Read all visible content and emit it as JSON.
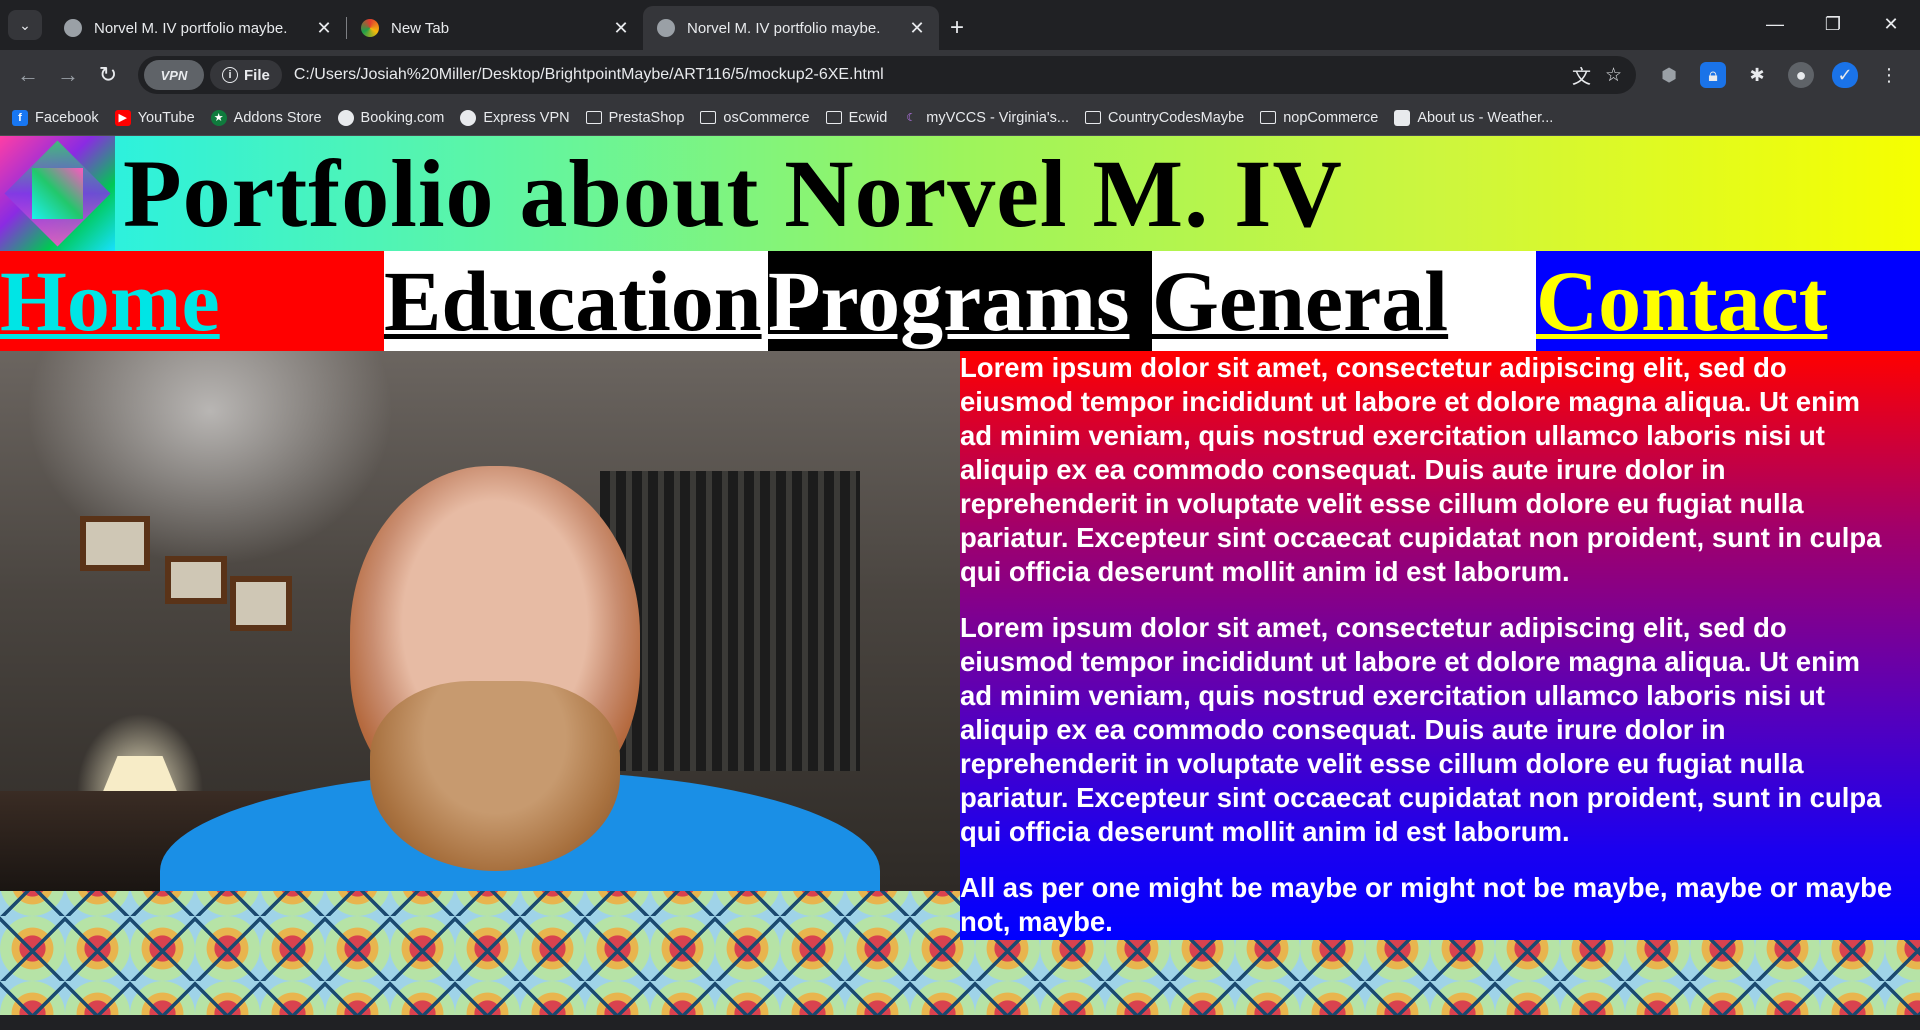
{
  "browser": {
    "tabs": [
      {
        "title": "Norvel M. IV portfolio maybe.",
        "active": false
      },
      {
        "title": "New Tab",
        "active": false
      },
      {
        "title": "Norvel M. IV portfolio maybe.",
        "active": true
      }
    ],
    "address": {
      "vpn_label": "VPN",
      "chip_label": "File",
      "url": "C:/Users/Josiah%20Miller/Desktop/BrightpointMaybe/ART116/5/mockup2-6XE.html"
    },
    "bookmarks": [
      {
        "label": "Facebook",
        "icon": "facebook-icon"
      },
      {
        "label": "YouTube",
        "icon": "youtube-icon"
      },
      {
        "label": "Addons Store",
        "icon": "addons-icon"
      },
      {
        "label": "Booking.com",
        "icon": "globe-icon"
      },
      {
        "label": "Express VPN",
        "icon": "globe-icon"
      },
      {
        "label": "PrestaShop",
        "icon": "folder-icon"
      },
      {
        "label": "osCommerce",
        "icon": "folder-icon"
      },
      {
        "label": "Ecwid",
        "icon": "folder-icon"
      },
      {
        "label": "myVCCS - Virginia's...",
        "icon": "vccs-icon"
      },
      {
        "label": "CountryCodesMaybe",
        "icon": "folder-icon"
      },
      {
        "label": "nopCommerce",
        "icon": "folder-icon"
      },
      {
        "label": "About us - Weather...",
        "icon": "page-icon"
      }
    ]
  },
  "page": {
    "title": "Portfolio about Norvel M. IV",
    "nav": [
      "Home",
      "Education",
      "Programs",
      "General",
      "Contact"
    ],
    "paragraphs": [
      "Lorem ipsum dolor sit amet, consectetur adipiscing elit, sed do eiusmod tempor incididunt ut labore et dolore magna aliqua. Ut enim ad minim veniam, quis nostrud exercitation ullamco laboris nisi ut aliquip ex ea commodo consequat. Duis aute irure dolor in reprehenderit in voluptate velit esse cillum dolore eu fugiat nulla pariatur. Excepteur sint occaecat cupidatat non proident, sunt in culpa qui officia deserunt mollit anim id est laborum.",
      "Lorem ipsum dolor sit amet, consectetur adipiscing elit, sed do eiusmod tempor incididunt ut labore et dolore magna aliqua. Ut enim ad minim veniam, quis nostrud exercitation ullamco laboris nisi ut aliquip ex ea commodo consequat. Duis aute irure dolor in reprehenderit in voluptate velit esse cillum dolore eu fugiat nulla pariatur. Excepteur sint occaecat cupidatat non proident, sunt in culpa qui officia deserunt mollit anim id est laborum.",
      "All as per one might be maybe or might not be maybe, maybe or maybe not, maybe."
    ]
  },
  "colors": {
    "nav_home_bg": "#ff0000",
    "nav_contact_bg": "#0000ff",
    "header_gradient_start": "#1ef0ee",
    "header_gradient_end": "#f6ff00"
  }
}
